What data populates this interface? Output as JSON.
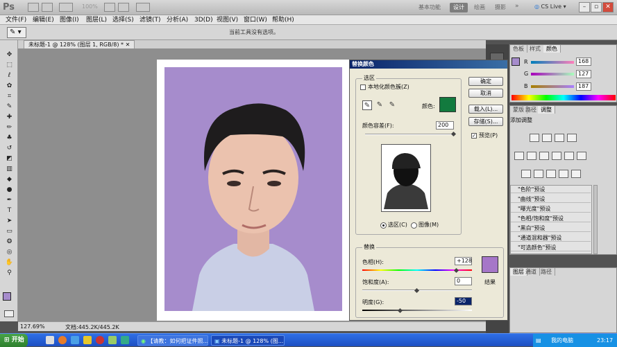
{
  "app": {
    "logo": "Ps",
    "zoom_display": "100%",
    "workspaces": [
      "基本功能",
      "设计",
      "绘画",
      "摄影"
    ],
    "active_workspace": "设计",
    "cs_live": "CS Live"
  },
  "menu": [
    "文件(F)",
    "编辑(E)",
    "图像(I)",
    "图层(L)",
    "选择(S)",
    "滤镜(T)",
    "分析(A)",
    "3D(D)",
    "视图(V)",
    "窗口(W)",
    "帮助(H)"
  ],
  "options_bar": {
    "hint": "当前工具没有选项。"
  },
  "document": {
    "tab_title": "未标题-1 @ 128% (图层 1, RGB/8) *",
    "status_zoom": "127.69%",
    "status_doc": "文档:445.2K/445.2K"
  },
  "colors": {
    "foreground": "#a68ccc",
    "background": "#ffffff",
    "photo_bg": "#a68ccc",
    "result": "#a677c8",
    "picker_color": "#127a3e"
  },
  "dialog": {
    "title": "替换颜色",
    "selection_group": "选区",
    "localized_clusters": "本地化颜色簇(Z)",
    "color_label": "颜色:",
    "fuzziness_label": "颜色容差(F):",
    "fuzziness_value": "200",
    "fuzziness_fraction": 1.0,
    "radio_selection": "选区(C)",
    "radio_image": "图像(M)",
    "buttons": {
      "ok": "确定",
      "cancel": "取消",
      "load": "载入(L)...",
      "save": "存储(S)..."
    },
    "preview": "预览(P)",
    "replace_group": "替换",
    "hue_label": "色相(H):",
    "hue_value": "+128",
    "hue_fraction": 0.86,
    "saturation_label": "饱和度(A):",
    "saturation_value": "0",
    "saturation_fraction": 0.5,
    "lightness_label": "明度(G):",
    "lightness_value": "-50",
    "lightness_fraction": 0.35,
    "result_label": "结果"
  },
  "color_panel": {
    "tabs": [
      "色板",
      "样式",
      "颜色"
    ],
    "active_tab": "颜色",
    "channels": [
      {
        "label": "R",
        "value": "168"
      },
      {
        "label": "G",
        "value": "127"
      },
      {
        "label": "B",
        "value": "187"
      }
    ]
  },
  "adjust_panel": {
    "tabs": [
      "蒙版",
      "路径",
      "调整"
    ],
    "active_tab": "调整",
    "heading": "添加调整",
    "presets": [
      "\"色阶\"预设",
      "\"曲线\"预设",
      "\"曝光度\"预设",
      "\"色相/饱和度\"预设",
      "\"黑白\"预设",
      "\"通道混和器\"预设",
      "\"可选颜色\"预设"
    ]
  },
  "layers_panel": {
    "tabs": [
      "图层",
      "通道",
      "路径"
    ]
  },
  "taskbar": {
    "start": "开始",
    "tasks": [
      "【请教：如何把证件照...",
      "未标题-1 @ 128% (图..."
    ],
    "tray_text": "我的电脑",
    "time": "23:17"
  }
}
